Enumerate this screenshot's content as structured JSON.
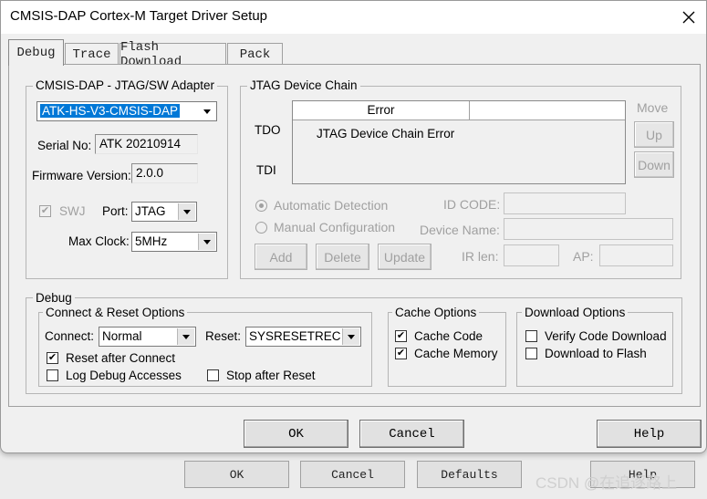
{
  "window": {
    "title": "CMSIS-DAP Cortex-M Target Driver Setup"
  },
  "tabs": [
    {
      "label": "Debug",
      "active": true
    },
    {
      "label": "Trace"
    },
    {
      "label": "Flash Download"
    },
    {
      "label": "Pack"
    }
  ],
  "adapter": {
    "group_label": "CMSIS-DAP - JTAG/SW Adapter",
    "selected_adapter": "ATK-HS-V3-CMSIS-DAP",
    "serial_label": "Serial No:",
    "serial_value": "ATK 20210914",
    "firmware_label": "Firmware Version:",
    "firmware_value": "2.0.0",
    "swj_label": "SWJ",
    "swj_checked": true,
    "port_label": "Port:",
    "port_value": "JTAG",
    "clock_label": "Max Clock:",
    "clock_value": "5MHz"
  },
  "jtag": {
    "group_label": "JTAG Device Chain",
    "tdo_label": "TDO",
    "tdi_label": "TDI",
    "column_error": "Error",
    "column_blank": "",
    "chain_message": "JTAG Device Chain Error",
    "move_label": "Move",
    "up_label": "Up",
    "down_label": "Down",
    "auto_detect_label": "Automatic Detection",
    "manual_config_label": "Manual Configuration",
    "id_code_label": "ID CODE:",
    "device_name_label": "Device Name:",
    "ir_len_label": "IR len:",
    "ap_label": "AP:",
    "add_label": "Add",
    "delete_label": "Delete",
    "update_label": "Update"
  },
  "debug": {
    "group_label": "Debug",
    "connect_reset_label": "Connect & Reset Options",
    "connect_label": "Connect:",
    "connect_value": "Normal",
    "reset_label": "Reset:",
    "reset_value": "SYSRESETREC",
    "reset_after_connect_label": "Reset after Connect",
    "log_debug_label": "Log Debug Accesses",
    "stop_after_reset_label": "Stop after Reset",
    "cache_group_label": "Cache Options",
    "cache_code_label": "Cache Code",
    "cache_memory_label": "Cache Memory",
    "download_group_label": "Download Options",
    "verify_download_label": "Verify Code Download",
    "download_flash_label": "Download to Flash"
  },
  "buttons": {
    "ok": "OK",
    "cancel": "Cancel",
    "help": "Help"
  },
  "back_window": {
    "ok": "OK",
    "cancel": "Cancel",
    "defaults": "Defaults",
    "help": "Help"
  },
  "watermark": "CSDN @在追逐路上"
}
